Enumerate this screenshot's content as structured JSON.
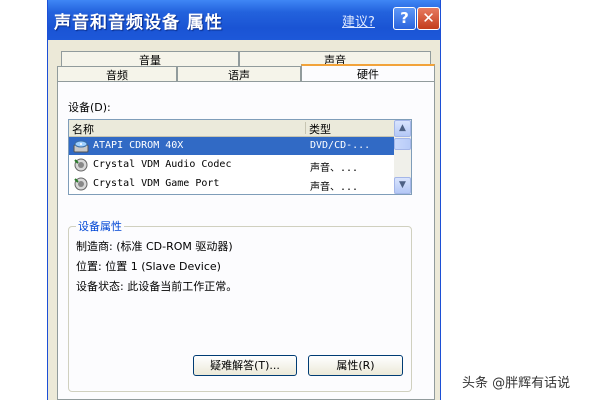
{
  "window": {
    "title": "声音和音频设备 属性",
    "help_link": "建议?",
    "help_button": "?",
    "close_button": "✕"
  },
  "tabs_row1": [
    "音量",
    "声音"
  ],
  "tabs_row2": [
    "音频",
    "语声",
    "硬件"
  ],
  "active_tab": "硬件",
  "devices": {
    "label": "设备(D):",
    "columns": [
      "名称",
      "类型"
    ],
    "rows": [
      {
        "name": "ATAPI CDROM 40X",
        "type": "DVD/CD-...",
        "selected": true,
        "icon": "cdrom-icon"
      },
      {
        "name": "Crystal VDM Audio Codec",
        "type": "声音、...",
        "selected": false,
        "icon": "audio-device-icon"
      },
      {
        "name": "Crystal VDM Game Port",
        "type": "声音、...",
        "selected": false,
        "icon": "audio-device-icon"
      }
    ]
  },
  "properties": {
    "title": "设备属性",
    "manufacturer": "制造商: (标准 CD-ROM 驱动器)",
    "location": "位置: 位置 1 (Slave Device)",
    "status": "设备状态: 此设备当前工作正常。"
  },
  "buttons": {
    "troubleshoot": "疑难解答(T)...",
    "properties": "属性(R)"
  },
  "watermark": "头条 @胖辉有话说",
  "colors": {
    "titlebar": "#2362dd",
    "selection": "#316ac5",
    "dialog_bg": "#ece9d8",
    "group_title": "#0046d5"
  }
}
